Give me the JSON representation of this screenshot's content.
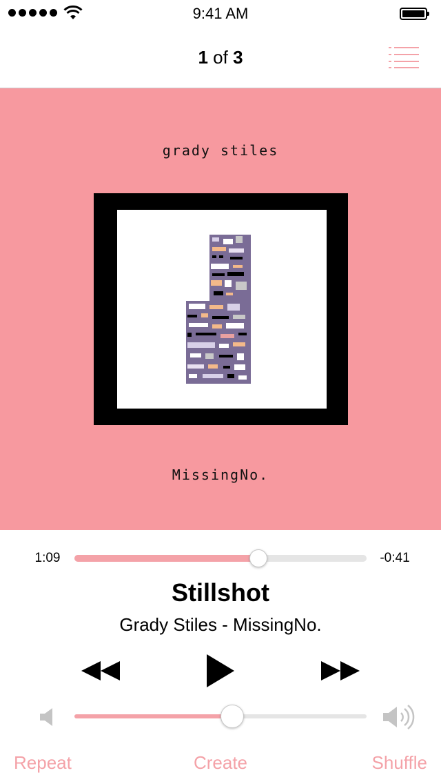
{
  "status_bar": {
    "time": "9:41 AM",
    "signal_icon": "signal-dots-icon",
    "wifi_icon": "wifi-icon",
    "battery_icon": "battery-icon"
  },
  "nav": {
    "track_index": "1",
    "of_label": "of",
    "track_total": "3",
    "list_icon": "list-icon"
  },
  "artwork": {
    "top_text": "grady stiles",
    "bottom_text": "MissingNo.",
    "background": "#f7999f"
  },
  "progress": {
    "elapsed": "1:09",
    "remaining": "-0:41",
    "fraction": 0.63
  },
  "song": {
    "title": "Stillshot",
    "artist_album": "Grady Stiles - MissingNo."
  },
  "controls": {
    "rewind_icon": "rewind-icon",
    "play_icon": "play-icon",
    "fast_forward_icon": "fast-forward-icon"
  },
  "volume": {
    "level": 0.54,
    "min_icon": "volume-low-icon",
    "max_icon": "volume-high-icon"
  },
  "bottom": {
    "repeat": "Repeat",
    "create": "Create",
    "shuffle": "Shuffle"
  },
  "colors": {
    "accent": "#f4a2a8",
    "track_bg": "#e5e5e5"
  }
}
